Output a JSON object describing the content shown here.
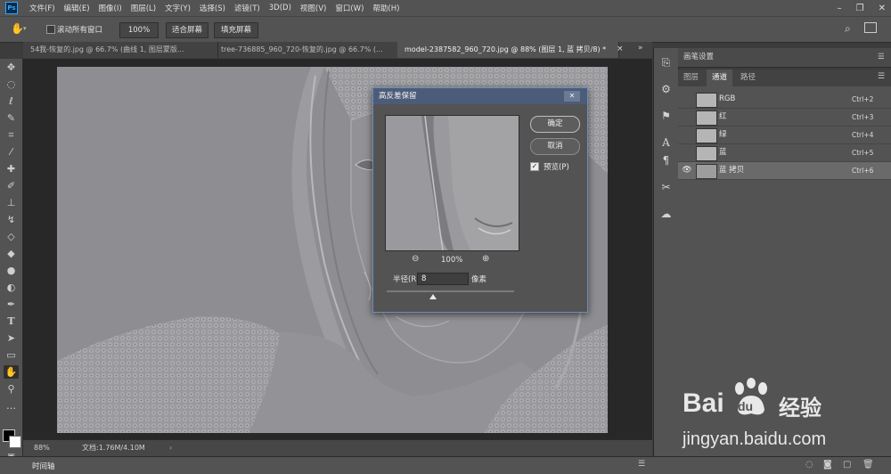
{
  "app": {
    "logo": "Ps"
  },
  "menu": [
    "文件(F)",
    "编辑(E)",
    "图像(I)",
    "图层(L)",
    "文字(Y)",
    "选择(S)",
    "滤镜(T)",
    "3D(D)",
    "视图(V)",
    "窗口(W)",
    "帮助(H)"
  ],
  "window_controls": {
    "minimize": "–",
    "restore": "❐",
    "close": "✕"
  },
  "options": {
    "scroll_all_label": "滚动所有窗口",
    "zoom_value": "100%",
    "fit_screen": "适合屏幕",
    "fill_screen": "填充屏幕"
  },
  "tabs": [
    {
      "label": "54我-恢复的.jpg @ 66.7% (曲线 1, 图层蒙版...",
      "close": "×"
    },
    {
      "label": "tree-736885_960_720-恢复的.jpg @ 66.7% (...",
      "close": "×"
    },
    {
      "label": "model-2387582_960_720.jpg @ 88% (图层 1, 蓝 拷贝/8) *",
      "close": "×"
    }
  ],
  "status": {
    "zoom": "88%",
    "doc": "文档:1.76M/4.10M"
  },
  "timeline_label": "时间轴",
  "panel": {
    "title": "画笔设置",
    "tabs": [
      "图层",
      "通道",
      "路径"
    ],
    "channels": [
      {
        "name": "RGB",
        "shortcut": "Ctrl+2"
      },
      {
        "name": "红",
        "shortcut": "Ctrl+3"
      },
      {
        "name": "绿",
        "shortcut": "Ctrl+4"
      },
      {
        "name": "蓝",
        "shortcut": "Ctrl+5"
      },
      {
        "name": "蓝 拷贝",
        "shortcut": "Ctrl+6"
      }
    ]
  },
  "dialog": {
    "title": "高反差保留",
    "ok": "确定",
    "cancel": "取消",
    "preview_label": "预览(P)",
    "preview_checked": true,
    "zoom": "100%",
    "radius_label": "半径(R):",
    "radius_value": "8",
    "radius_unit": "像素",
    "close": "✕"
  },
  "watermark": {
    "brand_left": "Bai",
    "brand_right": "du",
    "brand_cn": "经验",
    "url": "jingyan.baidu.com"
  }
}
